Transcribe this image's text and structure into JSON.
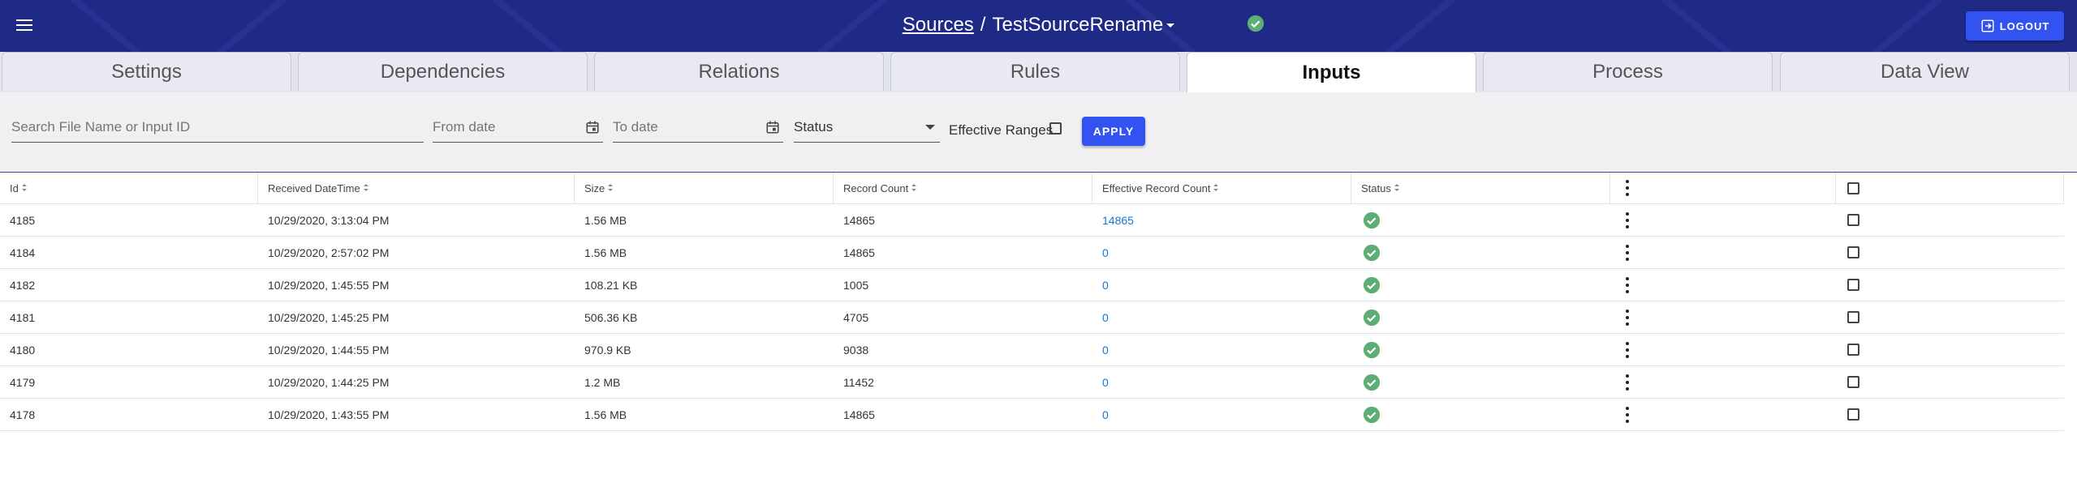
{
  "header": {
    "menu_icon": "hamburger-menu-icon",
    "breadcrumb_root": "Sources",
    "breadcrumb_sep": "/",
    "breadcrumb_current": "TestSourceRename",
    "status_icon": "check-circle-icon",
    "logout_label": "LOGOUT",
    "colors": {
      "background": "#1f2a87",
      "button": "#3352f2",
      "success": "#5cae72"
    }
  },
  "tabs": [
    {
      "label": "Settings",
      "active": false
    },
    {
      "label": "Dependencies",
      "active": false
    },
    {
      "label": "Relations",
      "active": false
    },
    {
      "label": "Rules",
      "active": false
    },
    {
      "label": "Inputs",
      "active": true
    },
    {
      "label": "Process",
      "active": false
    },
    {
      "label": "Data View",
      "active": false
    }
  ],
  "filters": {
    "search_placeholder": "Search File Name or Input ID",
    "from_date_placeholder": "From date",
    "to_date_placeholder": "To date",
    "status_placeholder": "Status",
    "effective_ranges_label": "Effective Ranges",
    "effective_ranges_checked": false,
    "apply_label": "APPLY"
  },
  "table": {
    "columns": [
      "Id",
      "Received DateTime",
      "Size",
      "Record Count",
      "Effective Record Count",
      "Status"
    ],
    "rows": [
      {
        "id": "4185",
        "received": "10/29/2020, 3:13:04 PM",
        "size": "1.56 MB",
        "records": "14865",
        "effective": "14865",
        "status": "success"
      },
      {
        "id": "4184",
        "received": "10/29/2020, 2:57:02 PM",
        "size": "1.56 MB",
        "records": "14865",
        "effective": "0",
        "status": "success"
      },
      {
        "id": "4182",
        "received": "10/29/2020, 1:45:55 PM",
        "size": "108.21 KB",
        "records": "1005",
        "effective": "0",
        "status": "success"
      },
      {
        "id": "4181",
        "received": "10/29/2020, 1:45:25 PM",
        "size": "506.36 KB",
        "records": "4705",
        "effective": "0",
        "status": "success"
      },
      {
        "id": "4180",
        "received": "10/29/2020, 1:44:55 PM",
        "size": "970.9 KB",
        "records": "9038",
        "effective": "0",
        "status": "success"
      },
      {
        "id": "4179",
        "received": "10/29/2020, 1:44:25 PM",
        "size": "1.2 MB",
        "records": "11452",
        "effective": "0",
        "status": "success"
      },
      {
        "id": "4178",
        "received": "10/29/2020, 1:43:55 PM",
        "size": "1.56 MB",
        "records": "14865",
        "effective": "0",
        "status": "success"
      }
    ]
  }
}
